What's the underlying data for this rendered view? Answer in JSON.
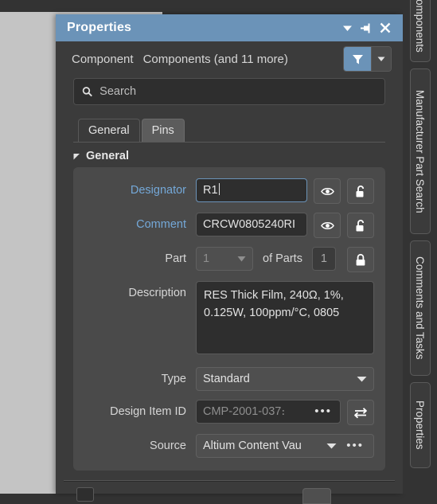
{
  "panel": {
    "title": "Properties",
    "titlebar_buttons": [
      {
        "name": "dropdown-icon",
        "label": "▼"
      },
      {
        "name": "dock-pin-icon",
        "label": "pin"
      },
      {
        "name": "close-icon",
        "label": "✕"
      }
    ]
  },
  "object_header": {
    "kind": "Component",
    "scope": "Components (and 11 more)",
    "filter_icon": "funnel-icon",
    "filter_dropdown_icon": "chevron-down-icon"
  },
  "search": {
    "placeholder": "Search",
    "value": "",
    "icon": "search-icon"
  },
  "tabs": [
    {
      "label": "General",
      "active": true
    },
    {
      "label": "Pins",
      "active": false
    }
  ],
  "sections": {
    "general": {
      "label": "General",
      "expanded": true,
      "collapse_icon": "triangle-down-icon"
    }
  },
  "fields": {
    "designator": {
      "label": "Designator",
      "value": "R1",
      "focused": true,
      "visibility_icon": "eye-icon",
      "lock_icon": "unlocked-padlock-icon",
      "locked": false
    },
    "comment": {
      "label": "Comment",
      "value": "CRCW0805240RI",
      "visibility_icon": "eye-icon",
      "lock_icon": "unlocked-padlock-icon",
      "locked": false
    },
    "part": {
      "label": "Part",
      "value": "1",
      "of_parts_label": "of Parts",
      "parts_total": "1",
      "lock_icon": "locked-padlock-icon",
      "locked": true,
      "disabled": true
    },
    "description": {
      "label": "Description",
      "value": "RES Thick Film, 240Ω, 1%, 0.125W, 100ppm/°C, 0805"
    },
    "type": {
      "label": "Type",
      "value": "Standard",
      "dropdown_icon": "chevron-down-icon"
    },
    "design_item_id": {
      "label": "Design Item ID",
      "value": "CMP-2001-037։",
      "ellipsis_label": "•••",
      "swap_icon": "swap-arrows-icon"
    },
    "source": {
      "label": "Source",
      "value": "Altium Content Vau",
      "dropdown_icon": "chevron-down-icon",
      "ellipsis_label": "•••"
    }
  },
  "right_rail": [
    {
      "label": "omponents"
    },
    {
      "label": "Manufacturer Part Search"
    },
    {
      "label": "Comments and Tasks"
    },
    {
      "label": "Properties"
    }
  ],
  "colors": {
    "accent": "#6b93b8",
    "panel_bg": "#3b3b3b",
    "group_bg": "#4a4a4a",
    "input_bg": "#2e2e2e",
    "link_text": "#74a8d8",
    "canvas": "#c4c4c4"
  }
}
